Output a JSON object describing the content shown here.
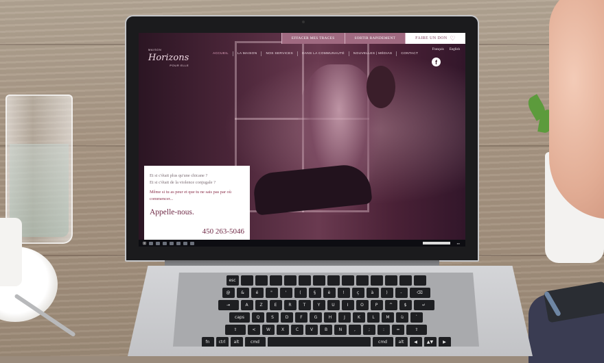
{
  "website": {
    "top_buttons": {
      "erase": "EFFACER MES TRACES",
      "exit": "SORTIR RAPIDEMENT",
      "donate": "FAIRE UN DON"
    },
    "logo": {
      "small_top": "MAISON",
      "main": "Horizons",
      "small_bottom": "POUR ELLE"
    },
    "nav": [
      "ACCUEIL",
      "LA MAISON",
      "NOS SERVICES",
      "DANS LA COMMUNAUTÉ",
      "NOUVELLES | MÉDIAS",
      "CONTACT"
    ],
    "languages": [
      "Français",
      "English"
    ],
    "social_icon": "facebook-icon",
    "card": {
      "question_1": "Et si c'était plus qu'une chicane ?",
      "question_2": "Et si c'était de la violence conjugale ?",
      "message": "Même si tu as peur et que tu ne sais pas par où commencer...",
      "call_to_action": "Appelle-nous.",
      "phone": "450 263-5046"
    },
    "colors": {
      "accent": "#a06a81",
      "brand_dark": "#6e2844",
      "hero_bg": "#4a2538"
    }
  },
  "keyboard": {
    "row1": [
      "esc",
      "",
      "",
      "",
      "",
      "",
      "",
      "",
      "",
      "",
      "",
      "",
      "",
      ""
    ],
    "row2": [
      "@",
      "&",
      "é",
      "\"",
      "'",
      "(",
      "§",
      "è",
      "!",
      "ç",
      "à",
      ")",
      "-",
      "⌫"
    ],
    "row3": [
      "⇥",
      "A",
      "Z",
      "E",
      "R",
      "T",
      "Y",
      "U",
      "I",
      "O",
      "P",
      "^",
      "$",
      "↵"
    ],
    "row4": [
      "caps",
      "Q",
      "S",
      "D",
      "F",
      "G",
      "H",
      "J",
      "K",
      "L",
      "M",
      "ù",
      "`"
    ],
    "row5": [
      "⇧",
      "<",
      "W",
      "X",
      "C",
      "V",
      "B",
      "N",
      ",",
      ";",
      ":",
      "=",
      "⇧"
    ],
    "row6": [
      "fn",
      "ctrl",
      "alt",
      "cmd",
      "",
      "cmd",
      "alt",
      "◀",
      "▲▼",
      "▶"
    ]
  }
}
